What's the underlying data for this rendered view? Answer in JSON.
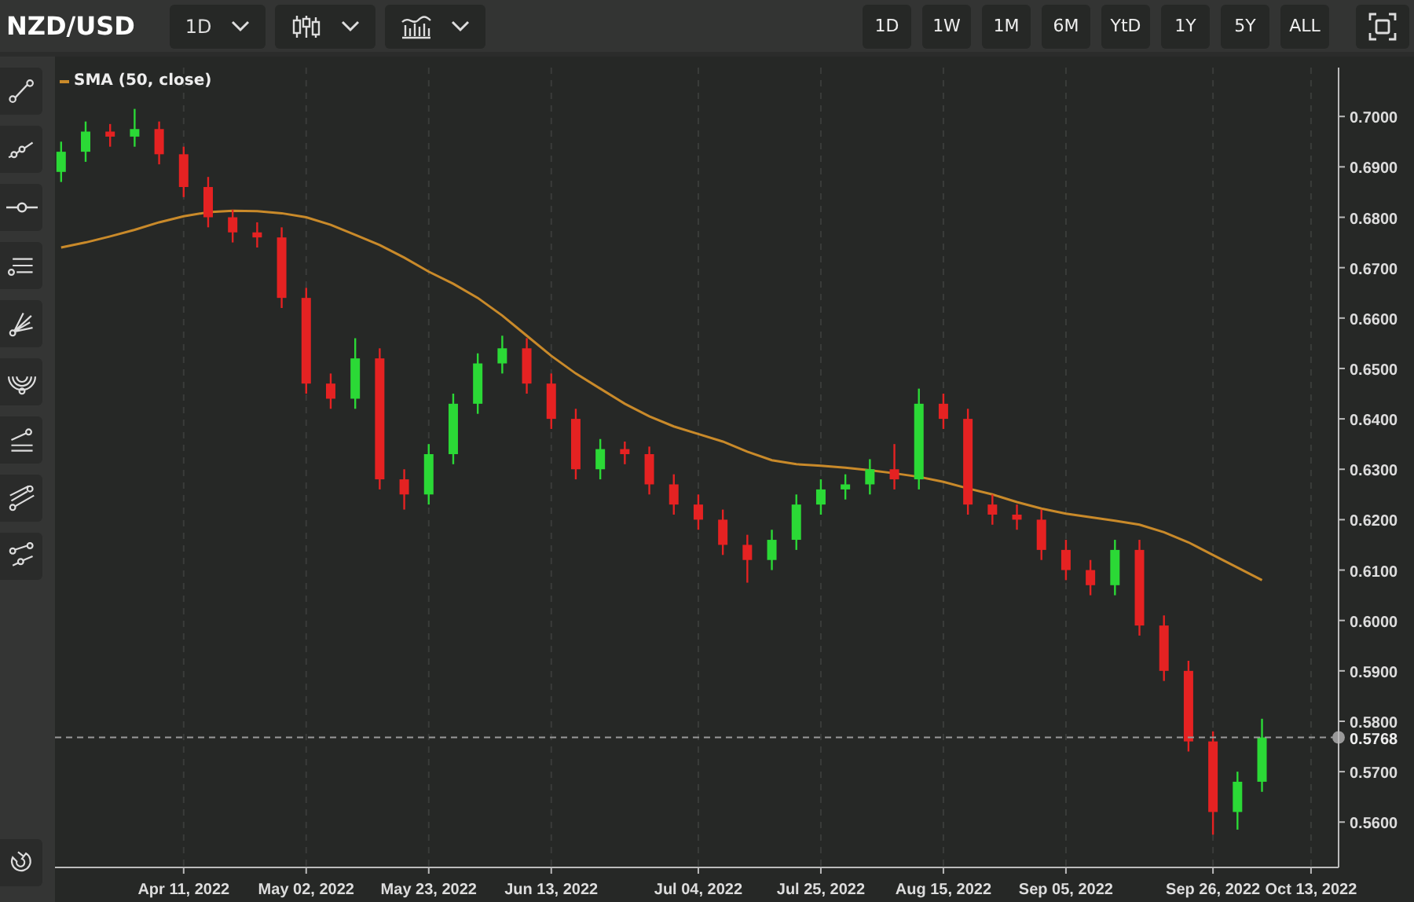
{
  "header": {
    "symbol": "NZD/USD",
    "interval": "1D"
  },
  "ranges": [
    "1D",
    "1W",
    "1M",
    "6M",
    "YtD",
    "1Y",
    "5Y",
    "ALL"
  ],
  "chart_data": {
    "type": "candlestick",
    "grid": true,
    "ylim": [
      0.551,
      0.7097
    ],
    "categories": [
      null,
      null,
      null,
      null,
      null,
      "Apr 11, 2022",
      null,
      null,
      null,
      null,
      "May 02, 2022",
      null,
      null,
      null,
      null,
      "May 23, 2022",
      null,
      null,
      null,
      null,
      "Jun 13, 2022",
      null,
      null,
      null,
      null,
      null,
      "Jul 04, 2022",
      null,
      null,
      null,
      null,
      "Jul 25, 2022",
      null,
      null,
      null,
      null,
      "Aug 15, 2022",
      null,
      null,
      null,
      null,
      "Sep 05, 2022",
      null,
      null,
      null,
      null,
      null,
      "Sep 26, 2022",
      null,
      null,
      null,
      "Oct 13, 2022"
    ],
    "ohlc": [
      [
        0.689,
        0.695,
        0.687,
        0.693
      ],
      [
        0.693,
        0.699,
        0.691,
        0.697
      ],
      [
        0.697,
        0.6985,
        0.694,
        0.696
      ],
      [
        0.696,
        0.7015,
        0.694,
        0.6975
      ],
      [
        0.6975,
        0.699,
        0.6905,
        0.6925
      ],
      [
        0.6925,
        0.694,
        0.684,
        0.686
      ],
      [
        0.686,
        0.688,
        0.678,
        0.68
      ],
      [
        0.68,
        0.6815,
        0.675,
        0.677
      ],
      [
        0.677,
        0.679,
        0.674,
        0.676
      ],
      [
        0.676,
        0.678,
        0.662,
        0.664
      ],
      [
        0.664,
        0.666,
        0.645,
        0.647
      ],
      [
        0.647,
        0.649,
        0.642,
        0.644
      ],
      [
        0.644,
        0.656,
        0.642,
        0.652
      ],
      [
        0.652,
        0.654,
        0.626,
        0.628
      ],
      [
        0.628,
        0.63,
        0.622,
        0.625
      ],
      [
        0.625,
        0.635,
        0.623,
        0.633
      ],
      [
        0.633,
        0.645,
        0.631,
        0.643
      ],
      [
        0.643,
        0.653,
        0.641,
        0.651
      ],
      [
        0.651,
        0.6565,
        0.649,
        0.654
      ],
      [
        0.654,
        0.656,
        0.645,
        0.647
      ],
      [
        0.647,
        0.649,
        0.638,
        0.64
      ],
      [
        0.64,
        0.642,
        0.628,
        0.63
      ],
      [
        0.63,
        0.636,
        0.628,
        0.634
      ],
      [
        0.634,
        0.6355,
        0.631,
        0.633
      ],
      [
        0.633,
        0.6345,
        0.625,
        0.627
      ],
      [
        0.627,
        0.629,
        0.621,
        0.623
      ],
      [
        0.623,
        0.625,
        0.618,
        0.62
      ],
      [
        0.62,
        0.622,
        0.613,
        0.615
      ],
      [
        0.615,
        0.617,
        0.6075,
        0.612
      ],
      [
        0.612,
        0.618,
        0.61,
        0.616
      ],
      [
        0.616,
        0.625,
        0.614,
        0.623
      ],
      [
        0.623,
        0.628,
        0.621,
        0.626
      ],
      [
        0.626,
        0.629,
        0.624,
        0.627
      ],
      [
        0.627,
        0.632,
        0.625,
        0.63
      ],
      [
        0.63,
        0.635,
        0.626,
        0.628
      ],
      [
        0.628,
        0.646,
        0.626,
        0.643
      ],
      [
        0.643,
        0.645,
        0.638,
        0.64
      ],
      [
        0.64,
        0.642,
        0.621,
        0.623
      ],
      [
        0.623,
        0.625,
        0.619,
        0.621
      ],
      [
        0.621,
        0.623,
        0.618,
        0.62
      ],
      [
        0.62,
        0.622,
        0.612,
        0.614
      ],
      [
        0.614,
        0.616,
        0.608,
        0.61
      ],
      [
        0.61,
        0.612,
        0.605,
        0.607
      ],
      [
        0.607,
        0.616,
        0.605,
        0.614
      ],
      [
        0.614,
        0.616,
        0.597,
        0.599
      ],
      [
        0.599,
        0.601,
        0.588,
        0.59
      ],
      [
        0.59,
        0.592,
        0.574,
        0.576
      ],
      [
        0.576,
        0.578,
        0.5575,
        0.562
      ],
      [
        0.562,
        0.57,
        0.5585,
        0.568
      ],
      [
        0.568,
        0.5805,
        0.566,
        0.5768
      ],
      null,
      null
    ],
    "yticks": [
      {
        "value": 0.56,
        "label": "0.5600"
      },
      {
        "value": 0.57,
        "label": "0.5700"
      },
      {
        "value": 0.58,
        "label": "0.5800"
      },
      {
        "value": 0.59,
        "label": "0.5900"
      },
      {
        "value": 0.6,
        "label": "0.6000"
      },
      {
        "value": 0.61,
        "label": "0.6100"
      },
      {
        "value": 0.62,
        "label": "0.6200"
      },
      {
        "value": 0.63,
        "label": "0.6300"
      },
      {
        "value": 0.64,
        "label": "0.6400"
      },
      {
        "value": 0.65,
        "label": "0.6500"
      },
      {
        "value": 0.66,
        "label": "0.6600"
      },
      {
        "value": 0.67,
        "label": "0.6700"
      },
      {
        "value": 0.68,
        "label": "0.6800"
      },
      {
        "value": 0.69,
        "label": "0.6900"
      },
      {
        "value": 0.7,
        "label": "0.7000"
      }
    ],
    "ref_lines": [
      {
        "axis": "y",
        "value": 0.5768,
        "label": "0.5768"
      }
    ],
    "series": [
      {
        "name": "SMA (50, close)",
        "type": "line",
        "color": "#c98a2a",
        "values": [
          0.674,
          0.675,
          0.6762,
          0.6775,
          0.679,
          0.6802,
          0.681,
          0.6813,
          0.6812,
          0.6808,
          0.68,
          0.6785,
          0.6765,
          0.6745,
          0.672,
          0.6692,
          0.6668,
          0.664,
          0.6605,
          0.6565,
          0.6525,
          0.649,
          0.646,
          0.643,
          0.6405,
          0.6385,
          0.637,
          0.6355,
          0.6335,
          0.6318,
          0.631,
          0.6307,
          0.6303,
          0.6298,
          0.6292,
          0.6285,
          0.6275,
          0.6262,
          0.625,
          0.6235,
          0.6222,
          0.6212,
          0.6205,
          0.6198,
          0.619,
          0.6175,
          0.6155,
          0.613,
          0.6105,
          0.608,
          null,
          null
        ]
      }
    ]
  }
}
